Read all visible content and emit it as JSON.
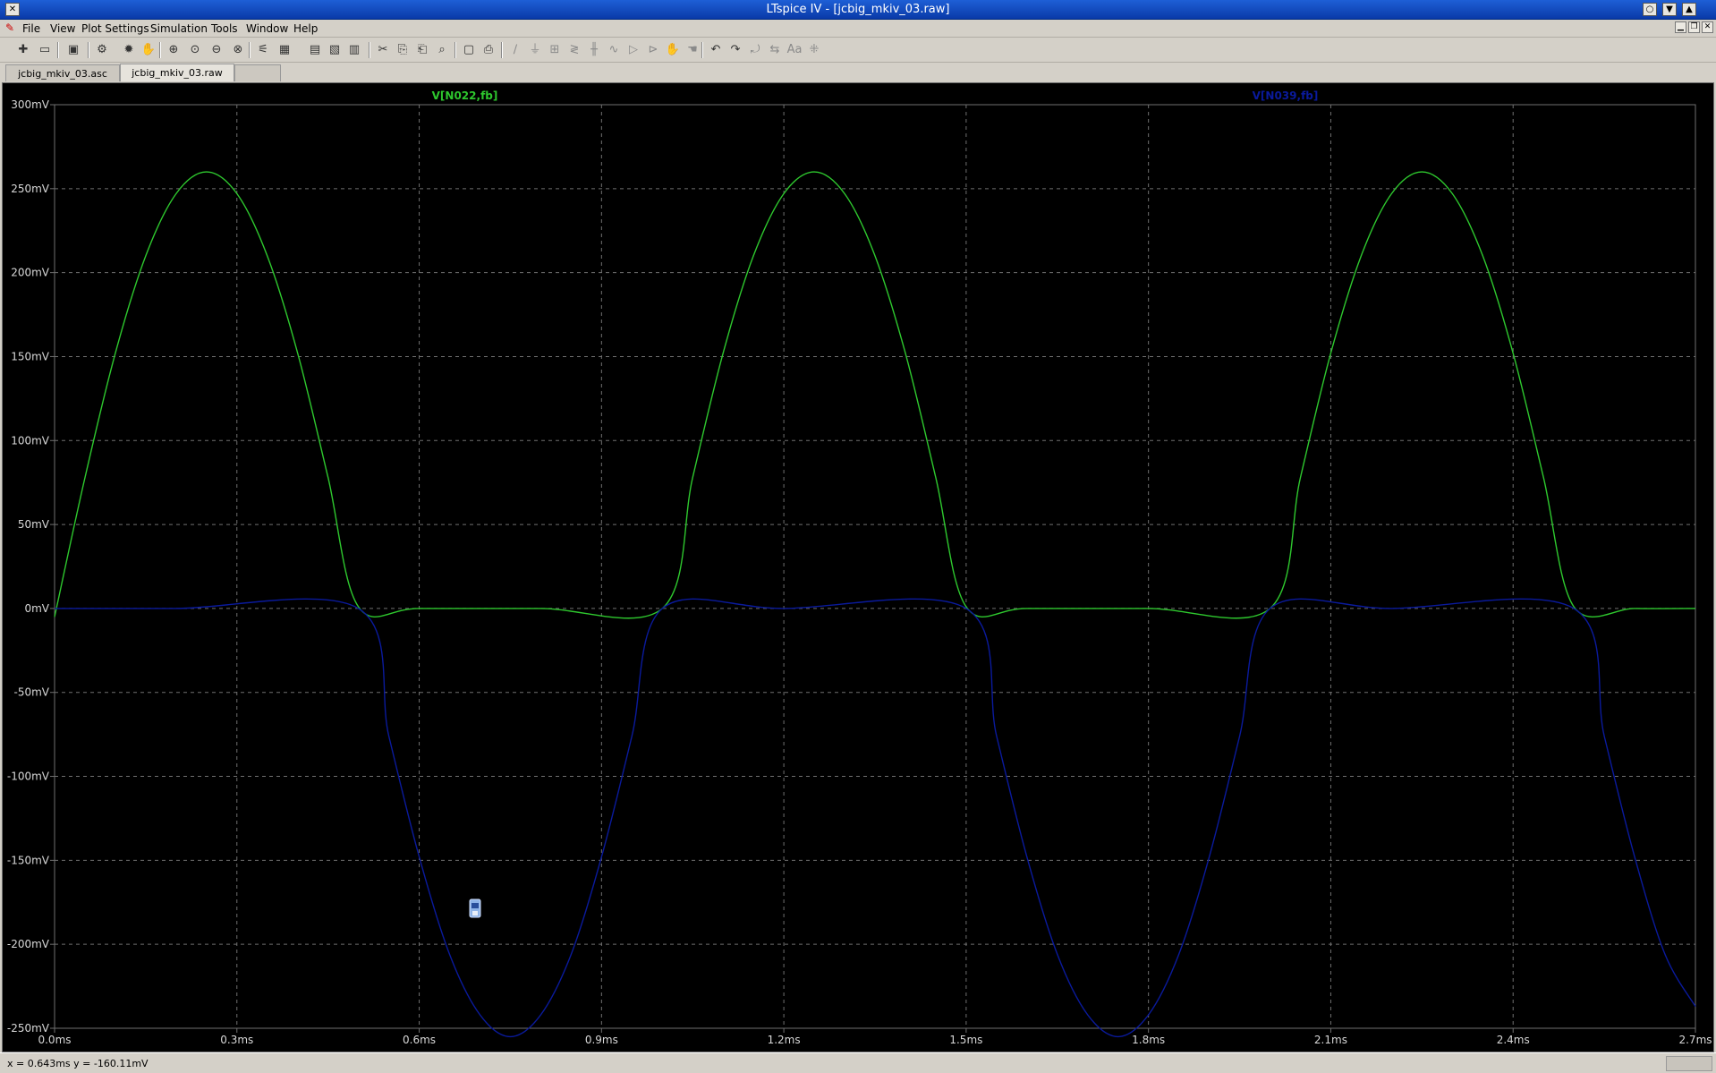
{
  "window": {
    "title": "LTspice IV - [jcbig_mkiv_03.raw]",
    "close_glyph": "✕",
    "restore_glyph": "○",
    "dropdown_glyph": "▼",
    "minimize_glyph": "▲"
  },
  "menubar": {
    "items": [
      "File",
      "View",
      "Plot Settings",
      "Simulation",
      "Tools",
      "Window",
      "Help"
    ]
  },
  "toolbar": {
    "icons": [
      "new-schematic-icon",
      "open-icon",
      "save-icon",
      "control-panel-icon",
      "run-icon",
      "halt-icon",
      "zoom-in-icon",
      "zoom-full-icon",
      "zoom-back-icon",
      "zoom-cancel-icon",
      "autorange-icon",
      "grid-icon",
      "tile-horizontal-icon",
      "cascade-icon",
      "tile-vertical-icon",
      "cut-icon",
      "copy-icon",
      "paste-icon",
      "find-icon",
      "print-setup-icon",
      "print-icon",
      "wire-icon",
      "ground-icon",
      "label-icon",
      "resistor-icon",
      "capacitor-icon",
      "inductor-icon",
      "diode-icon",
      "component-icon",
      "move-icon",
      "drag-icon",
      "undo-icon",
      "redo-icon",
      "rotate-icon",
      "mirror-icon",
      "text-icon",
      "spice-directive-icon"
    ]
  },
  "tabs": [
    {
      "label": "jcbig_mkiv_03.asc",
      "active": false
    },
    {
      "label": "jcbig_mkiv_03.raw",
      "active": true
    },
    {
      "label": "",
      "active": false
    }
  ],
  "colors": {
    "background": "#000000",
    "grid": "#707070",
    "axis_text": "#d8d8d8",
    "trace1": "#2ec82e",
    "trace2": "#0a1a9c"
  },
  "chart_data": {
    "type": "line",
    "title": "",
    "xlabel": "",
    "ylabel": "",
    "xlim": [
      0.0,
      2.7
    ],
    "ylim": [
      -250,
      300
    ],
    "x_unit": "ms",
    "y_unit": "mV",
    "xticks": [
      "0.0ms",
      "0.3ms",
      "0.6ms",
      "0.9ms",
      "1.2ms",
      "1.5ms",
      "1.8ms",
      "2.1ms",
      "2.4ms",
      "2.7ms"
    ],
    "yticks": [
      "300mV",
      "250mV",
      "200mV",
      "150mV",
      "100mV",
      "50mV",
      "0mV",
      "-50mV",
      "-100mV",
      "-150mV",
      "-200mV",
      "-250mV"
    ],
    "grid": true,
    "series": [
      {
        "name": "V[N022,fb]",
        "x": [
          0.0,
          0.05,
          0.1,
          0.15,
          0.2,
          0.25,
          0.3,
          0.35,
          0.4,
          0.45,
          0.5,
          0.6,
          0.8,
          1.0,
          1.05,
          1.1,
          1.15,
          1.2,
          1.25,
          1.3,
          1.35,
          1.4,
          1.45,
          1.5,
          1.6,
          1.8,
          2.0,
          2.05,
          2.1,
          2.15,
          2.2,
          2.25,
          2.3,
          2.35,
          2.4,
          2.45,
          2.5,
          2.6,
          2.7
        ],
        "y": [
          -5,
          78,
          152,
          210,
          247,
          260,
          247,
          210,
          152,
          78,
          1,
          0,
          0,
          0,
          78,
          152,
          210,
          247,
          260,
          247,
          210,
          152,
          78,
          1,
          0,
          0,
          0,
          78,
          152,
          210,
          247,
          260,
          247,
          210,
          152,
          78,
          1,
          0,
          0
        ]
      },
      {
        "name": "V[N039,fb]",
        "x": [
          0.0,
          0.2,
          0.5,
          0.55,
          0.6,
          0.65,
          0.7,
          0.75,
          0.8,
          0.85,
          0.9,
          0.95,
          1.0,
          1.2,
          1.5,
          1.55,
          1.6,
          1.65,
          1.7,
          1.75,
          1.8,
          1.85,
          1.9,
          1.95,
          2.0,
          2.2,
          2.5,
          2.55,
          2.6,
          2.65,
          2.7
        ],
        "y": [
          0,
          0,
          0,
          -76,
          -148,
          -206,
          -242,
          -255,
          -242,
          -206,
          -148,
          -76,
          0,
          0,
          0,
          -76,
          -148,
          -206,
          -242,
          -255,
          -242,
          -206,
          -148,
          -76,
          0,
          0,
          0,
          -76,
          -148,
          -206,
          -237
        ]
      }
    ]
  },
  "cursor": {
    "icon": "probe-cursor-icon"
  },
  "status": {
    "readout": "x = 0.643ms   y = -160.11mV"
  }
}
